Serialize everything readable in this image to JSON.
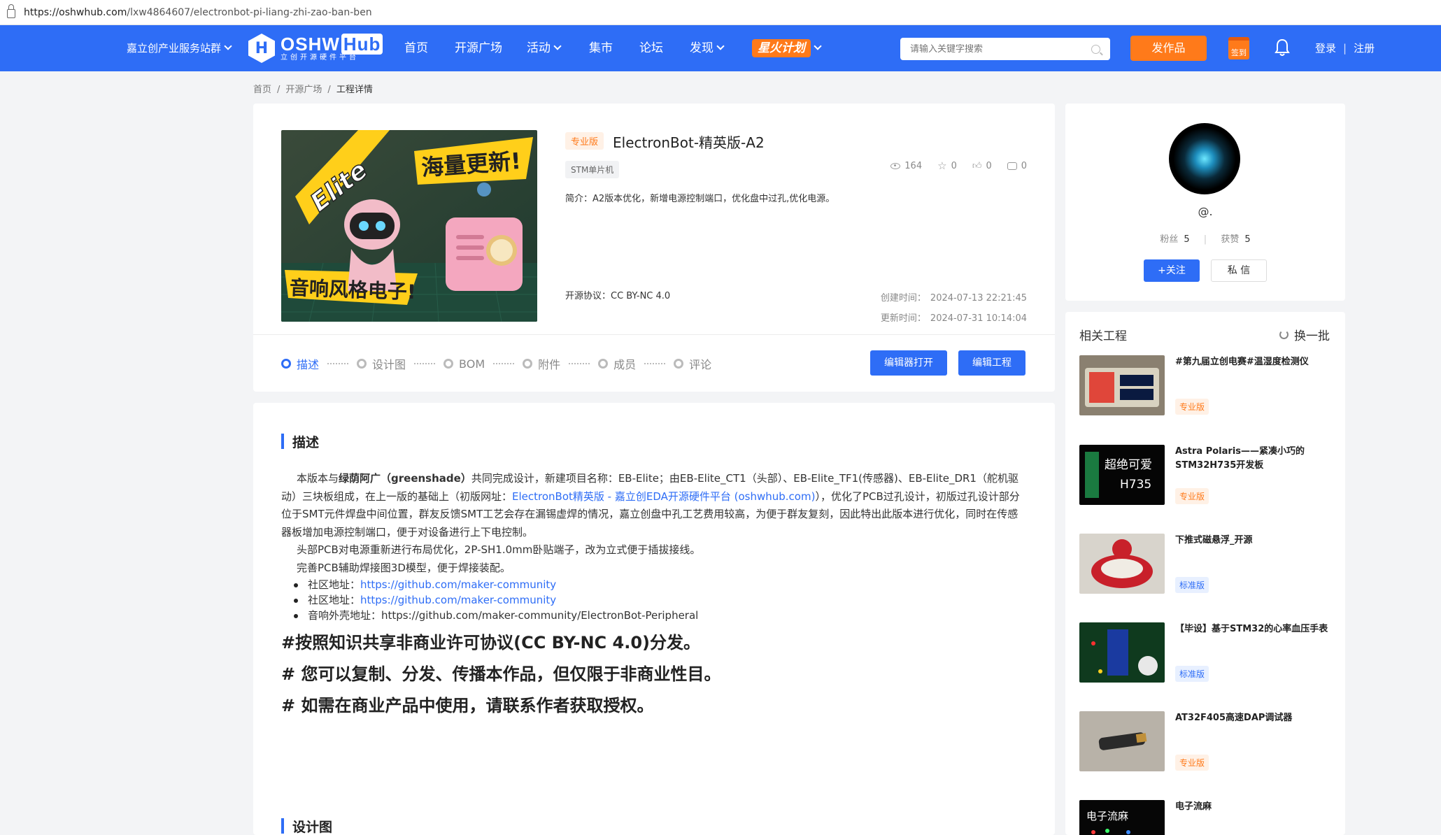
{
  "browser": {
    "url_host": "https://oshwhub.com",
    "url_path": "/lxw4864607/electronbot-pi-liang-zhi-zao-ban-ben"
  },
  "nav": {
    "site_group": "嘉立创产业服务站群",
    "logo_text": "OSHW",
    "logo_hub": "Hub",
    "logo_sub": "立创开源硬件平台",
    "items": [
      "首页",
      "开源广场",
      "活动",
      "集市",
      "论坛",
      "发现"
    ],
    "plan": "星火计划",
    "search_placeholder": "请输入关键字搜索",
    "publish": "发作品",
    "checkin": "签到",
    "login": "登录",
    "register": "注册"
  },
  "breadcrumb": [
    "首页",
    "开源广场",
    "工程详情"
  ],
  "project": {
    "tag": "专业版",
    "title": "ElectronBot-精英版-A2",
    "category": "STM单片机",
    "views": "164",
    "stars": "0",
    "likes": "0",
    "comments": "0",
    "intro": "简介：A2版本优化，新增电源控制端口，优化盘中过孔,优化电源。",
    "license": "开源协议：CC BY-NC 4.0",
    "created_label": "创建时间：",
    "created": "2024-07-13 22:21:45",
    "updated_label": "更新时间：",
    "updated": "2024-07-31 10:14:04",
    "cover_text": {
      "elite": "Elite",
      "top": "海量更新!",
      "bottom": "音响风格电子!"
    }
  },
  "steps": [
    "描述",
    "设计图",
    "BOM",
    "附件",
    "成员",
    "评论"
  ],
  "buttons": {
    "open_editor": "编辑器打开",
    "edit_project": "编辑工程"
  },
  "description": {
    "title": "描述",
    "p1_a": "本版本与",
    "p1_bold": "绿荫阿广（greenshade）",
    "p1_b": "共同完成设计，新建项目名称：EB-Elite；由EB-Elite_CT1（头部）、EB-Elite_TF1(传感器)、EB-Elite_DR1（舵机驱动）三块板组成，在上一版的基础上（初版网址：",
    "p1_link": "ElectronBot精英版 - 嘉立创EDA开源硬件平台 (oshwhub.com)",
    "p1_c": "），优化了PCB过孔设计，初版过孔设计部分位于SMT元件焊盘中间位置，群友反馈SMT工艺会存在漏锡虚焊的情况，嘉立创盘中孔工艺费用较高，为便于群友复刻，因此特出此版本进行优化，同时在传感器板增加电源控制端口，便于对设备进行上下电控制。",
    "p2": "头部PCB对电源重新进行布局优化，2P-SH1.0mm卧贴端子，改为立式便于插拔接线。",
    "p3": "完善PCB辅助焊接图3D模型，便于焊接装配。",
    "list": [
      {
        "label": "社区地址：",
        "value": "https://github.com/maker-community"
      },
      {
        "label": "社区地址：",
        "value": "https://github.com/maker-community"
      },
      {
        "label": "音响外壳地址：",
        "value": "https://github.com/maker-community/ElectronBot-Peripheral"
      }
    ],
    "big1": "#按照知识共享非商业许可协议(CC BY-NC 4.0)分发。",
    "big2": "# 您可以复制、分发、传播本作品，但仅限于非商业性目。",
    "big3": "# 如需在商业产品中使用，请联系作者获取授权。",
    "next_title": "设计图"
  },
  "author": {
    "name": "@.",
    "fans_label": "粉丝",
    "fans": "5",
    "likes_label": "获赞",
    "likes": "5",
    "follow": "+关注",
    "message": "私 信"
  },
  "related": {
    "title": "相关工程",
    "refresh": "换一批",
    "items": [
      {
        "title": "#第九届立创电赛#温湿度检测仪",
        "tag": "专业版"
      },
      {
        "title": "Astra Polaris——紧凑小巧的STM32H735开发板",
        "tag": "专业版",
        "thumb_text": "超绝可爱",
        "thumb_sub": "H735"
      },
      {
        "title": "下推式磁悬浮_开源",
        "tag": "标准版"
      },
      {
        "title": "【毕设】基于STM32的心率血压手表",
        "tag": "标准版"
      },
      {
        "title": "AT32F405高速DAP调试器",
        "tag": "专业版"
      },
      {
        "title": "电子流麻",
        "thumb_text": "电子流麻"
      }
    ]
  },
  "colors": {
    "primary": "#2e6df6",
    "accent": "#ff7a1a"
  }
}
